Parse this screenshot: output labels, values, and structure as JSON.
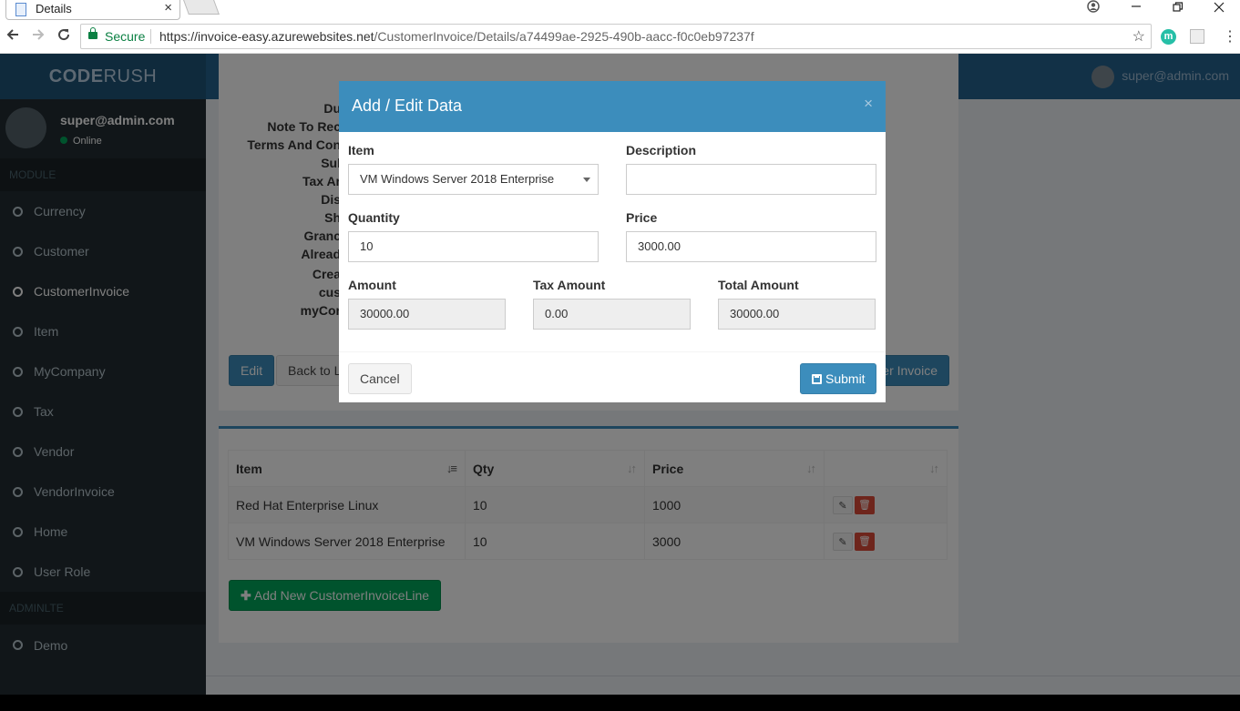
{
  "browser": {
    "tab_title": "Details",
    "tab_close": "×",
    "secure_label": "Secure",
    "url_host": "https://invoice-easy.azurewebsites.net",
    "url_path": "/CustomerInvoice/Details/a74499ae-2925-490b-aacc-f0c0eb97237f",
    "ext_m": "m"
  },
  "app": {
    "logo_bold": "CODE",
    "logo_rest": "RUSH",
    "top_user": "super@admin.com"
  },
  "sidebar": {
    "user_name": "super@admin.com",
    "user_status": "Online",
    "header_module": "MODULE",
    "header_adminlte": "ADMINLTE",
    "items": [
      {
        "label": "Currency"
      },
      {
        "label": "Customer"
      },
      {
        "label": "CustomerInvoice"
      },
      {
        "label": "Item"
      },
      {
        "label": "MyCompany"
      },
      {
        "label": "Tax"
      },
      {
        "label": "Vendor"
      },
      {
        "label": "VendorInvoice"
      },
      {
        "label": "Home"
      },
      {
        "label": "User Role"
      }
    ],
    "demo": "Demo"
  },
  "details": {
    "labels": [
      "Du",
      "Note To Rec",
      "Terms And Con",
      "Sul",
      "Tax Ar",
      "Dis",
      "Sh",
      "Granc",
      "Alread",
      "Crea",
      "cus",
      "myCor"
    ],
    "edit_button": "Edit",
    "back_button": "Back to Li",
    "right_button": "er Invoice"
  },
  "lines_table": {
    "headers": [
      "Item",
      "Qty",
      "Price",
      ""
    ],
    "rows": [
      {
        "item": "Red Hat Enterprise Linux",
        "qty": "10",
        "price": "1000"
      },
      {
        "item": "VM Windows Server 2018 Enterprise",
        "qty": "10",
        "price": "3000"
      }
    ],
    "add_button": "Add New CustomerInvoiceLine"
  },
  "modal": {
    "title": "Add / Edit Data",
    "close": "×",
    "item_label": "Item",
    "item_value": "VM Windows Server 2018 Enterprise",
    "description_label": "Description",
    "description_value": "",
    "quantity_label": "Quantity",
    "quantity_value": "10",
    "price_label": "Price",
    "price_value": "3000.00",
    "amount_label": "Amount",
    "amount_value": "30000.00",
    "tax_label": "Tax Amount",
    "tax_value": "0.00",
    "total_label": "Total Amount",
    "total_value": "30000.00",
    "cancel_button": "Cancel",
    "submit_button": "Submit"
  },
  "colors": {
    "brand": "#3c8dbc",
    "header": "#25638f",
    "sidebar": "#222d32",
    "success": "#00a65a",
    "danger": "#dd4b39"
  }
}
